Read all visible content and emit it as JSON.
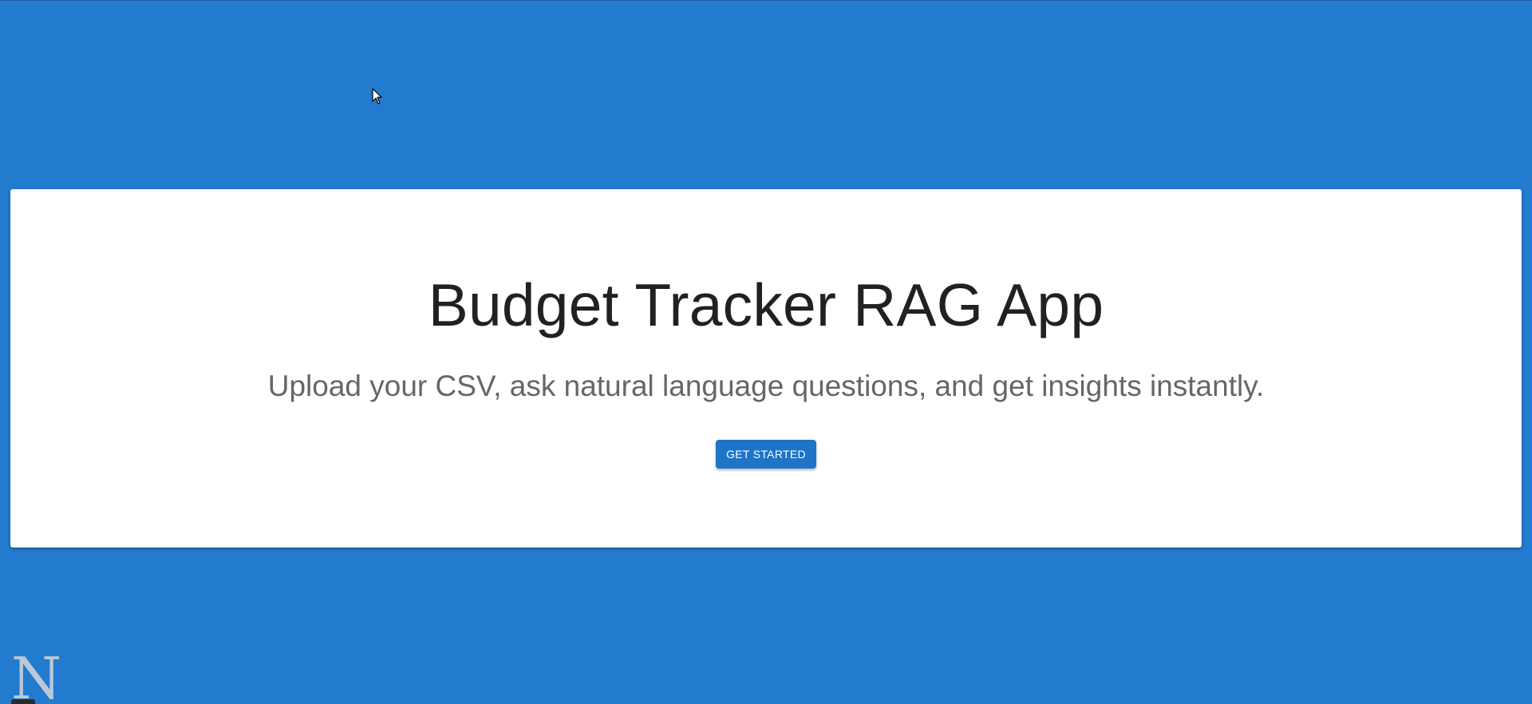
{
  "hero": {
    "title": "Budget Tracker RAG App",
    "subtitle": "Upload your CSV, ask natural language questions, and get insights instantly.",
    "cta_label": "GET STARTED"
  },
  "corner_logo": {
    "letter": "N"
  },
  "colors": {
    "page_background": "#237bd0",
    "card_background": "#ffffff",
    "button_background": "#1e74c6",
    "title_text": "#212121",
    "subtitle_text": "#666666"
  },
  "icons": {
    "cursor": "mouse-pointer-icon",
    "logo": "n-logo-icon"
  }
}
